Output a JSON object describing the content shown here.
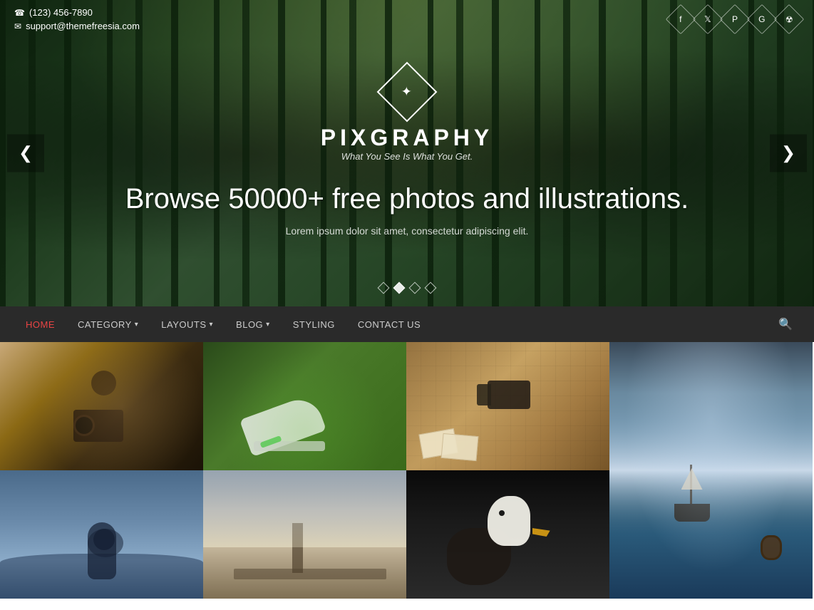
{
  "site": {
    "phone": "(123) 456-7890",
    "email": "support@themefreesia.com",
    "logo_symbol": "✦",
    "title": "PIXGRAPHY",
    "tagline": "What You See Is What You Get.",
    "hero_heading": "Browse 50000+ free photos and illustrations.",
    "hero_desc": "Lorem ipsum dolor sit amet, consectetur adipiscing elit.",
    "prev_label": "❮",
    "next_label": "❯"
  },
  "social": {
    "items": [
      {
        "name": "facebook",
        "icon": "f"
      },
      {
        "name": "twitter",
        "icon": "t"
      },
      {
        "name": "pinterest",
        "icon": "p"
      },
      {
        "name": "google-plus",
        "icon": "g"
      },
      {
        "name": "instagram",
        "icon": "i"
      }
    ]
  },
  "nav": {
    "items": [
      {
        "id": "home",
        "label": "HOME",
        "active": true,
        "has_dropdown": false
      },
      {
        "id": "category",
        "label": "CATEGORY",
        "active": false,
        "has_dropdown": true
      },
      {
        "id": "layouts",
        "label": "LAYOUTS",
        "active": false,
        "has_dropdown": true
      },
      {
        "id": "blog",
        "label": "BLOG",
        "active": false,
        "has_dropdown": true
      },
      {
        "id": "styling",
        "label": "STYLING",
        "active": false,
        "has_dropdown": false
      },
      {
        "id": "contact",
        "label": "CONTACT US",
        "active": false,
        "has_dropdown": false
      }
    ]
  },
  "dots": [
    {
      "id": 1,
      "active": false
    },
    {
      "id": 2,
      "active": true
    },
    {
      "id": 3,
      "active": false
    },
    {
      "id": 4,
      "active": false
    }
  ],
  "colors": {
    "nav_bg": "#2a2a2a",
    "active_color": "#e84444",
    "nav_text": "#cccccc"
  }
}
